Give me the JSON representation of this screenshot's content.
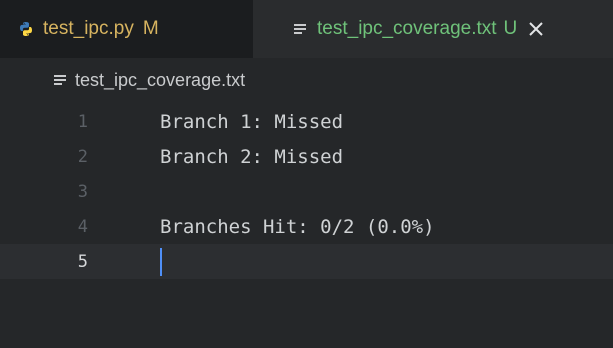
{
  "tabs": [
    {
      "label": "test_ipc.py",
      "status": "M",
      "icon": "python-file-icon"
    },
    {
      "label": "test_ipc_coverage.txt",
      "status": "U",
      "icon": "text-file-icon",
      "active": true
    }
  ],
  "breadcrumb": {
    "label": "test_ipc_coverage.txt",
    "icon": "text-file-icon"
  },
  "code": {
    "lines": [
      {
        "number": "1",
        "text": "Branch 1: Missed"
      },
      {
        "number": "2",
        "text": "Branch 2: Missed"
      },
      {
        "number": "3",
        "text": ""
      },
      {
        "number": "4",
        "text": "Branches Hit: 0/2 (0.0%)"
      },
      {
        "number": "5",
        "text": ""
      }
    ],
    "current_line": "5"
  },
  "colors": {
    "modified": "#d7b460",
    "untracked": "#6fc27a",
    "cursor": "#4f8ff7",
    "python_blue": "#3d7ab8",
    "python_yellow": "#ffd845"
  }
}
